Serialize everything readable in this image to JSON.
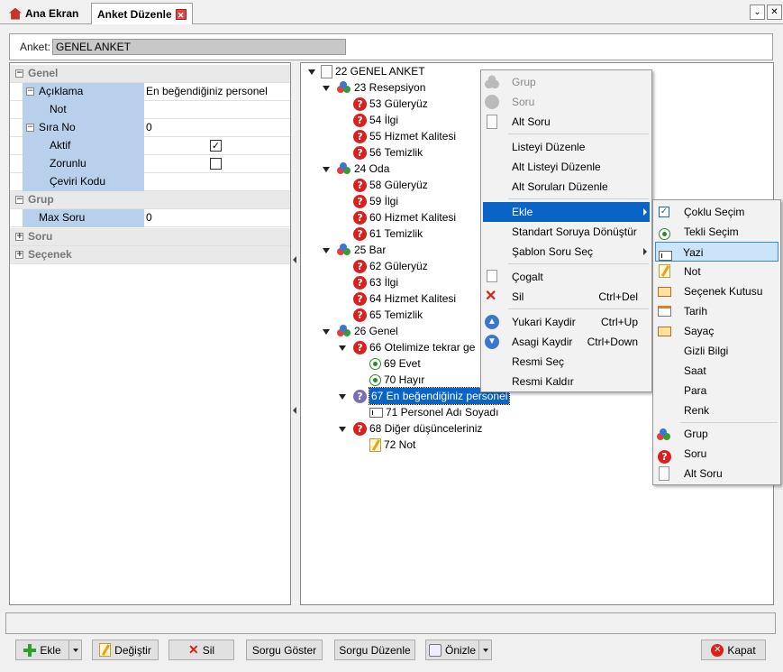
{
  "tabs": [
    {
      "label": "Ana Ekran"
    },
    {
      "label": "Anket Düzenle"
    }
  ],
  "window": {
    "dropdown": "⌄",
    "close": "✕"
  },
  "anket": {
    "label": "Anket:",
    "value": "GENEL ANKET"
  },
  "props": {
    "genel": "Genel",
    "aciklama": "Açıklama",
    "aciklama_val": "En beğendiğiniz personel",
    "not": "Not",
    "sira_no": "Sıra No",
    "sira_val": "0",
    "aktif": "Aktif",
    "zorunlu": "Zorunlu",
    "ceviri_kodu": "Çeviri Kodu",
    "grup": "Grup",
    "max_soru": "Max Soru",
    "max_val": "0",
    "soru": "Soru",
    "secenek": "Seçenek"
  },
  "tree": {
    "root": "22 GENEL ANKET",
    "n23": "23 Resepsiyon",
    "n53": "53 Güleryüz",
    "n54": "54 İlgi",
    "n55": "55 Hizmet Kalitesi",
    "n56": "56 Temizlik",
    "n24": "24 Oda",
    "n58": "58 Güleryüz",
    "n59": "59 İlgi",
    "n60": "60 Hizmet Kalitesi",
    "n61": "61 Temizlik",
    "n25": "25 Bar",
    "n62": "62 Güleryüz",
    "n63": "63 İlgi",
    "n64": "64 Hizmet Kalitesi",
    "n65": "65 Temizlik",
    "n26": "26 Genel",
    "n66": "66 Otelimize tekrar ge",
    "n69": "69 Evet",
    "n70": "70 Hayır",
    "n67": "67 En beğendiğiniz personel",
    "n71": "71 Personel Adı Soyadı",
    "n68": "68 Diğer düşünceleriniz",
    "n72": "72 Not"
  },
  "context_menu": {
    "grup": "Grup",
    "soru": "Soru",
    "alt_soru": "Alt Soru",
    "listeyi_duzenle": "Listeyi Düzenle",
    "alt_listeyi_duzenle": "Alt Listeyi Düzenle",
    "alt_sorulari_duzenle": "Alt Soruları Düzenle",
    "ekle": "Ekle",
    "standart": "Standart Soruya Dönüştür",
    "sablon": "Şablon Soru Seç",
    "cogalt": "Çogalt",
    "sil": "Sil",
    "sil_sc": "Ctrl+Del",
    "yukari": "Yukari Kaydir",
    "yukari_sc": "Ctrl+Up",
    "asagi": "Asagi Kaydir",
    "asagi_sc": "Ctrl+Down",
    "resmi_sec": "Resmi Seç",
    "resmi_kaldir": "Resmi Kaldır"
  },
  "submenu": {
    "coklu": "Çoklu Seçim",
    "tekli": "Tekli Seçim",
    "yazi": "Yazi",
    "not": "Not",
    "secenek_kutusu": "Seçenek Kutusu",
    "tarih": "Tarih",
    "sayac": "Sayaç",
    "gizli": "Gizli Bilgi",
    "saat": "Saat",
    "para": "Para",
    "renk": "Renk",
    "grup": "Grup",
    "soru": "Soru",
    "alt_soru": "Alt Soru"
  },
  "buttons": {
    "ekle": "Ekle",
    "degistir": "Değiştir",
    "sil": "Sil",
    "sorgu_goster": "Sorgu Göster",
    "sorgu_duzenle": "Sorgu Düzenle",
    "onizle": "Önizle",
    "kapat": "Kapat"
  },
  "colors": {
    "selection": "#0a64c8",
    "property_label_bg": "#b8d0ec",
    "question_icon": "#d8201e"
  }
}
